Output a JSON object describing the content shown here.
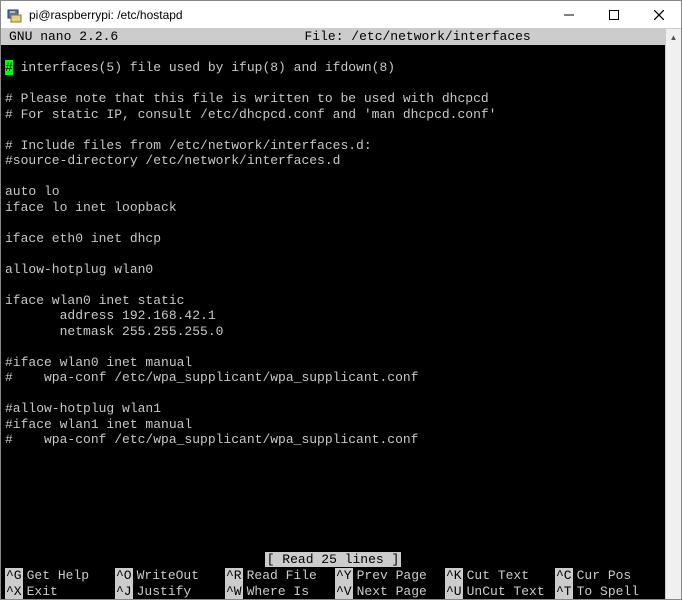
{
  "window": {
    "title": "pi@raspberrypi: /etc/hostapd"
  },
  "nano": {
    "app": "GNU nano 2.2.6",
    "file_label": "File: /etc/network/interfaces",
    "lines": [
      "# interfaces(5) file used by ifup(8) and ifdown(8)",
      "",
      "# Please note that this file is written to be used with dhcpcd",
      "# For static IP, consult /etc/dhcpcd.conf and 'man dhcpcd.conf'",
      "",
      "# Include files from /etc/network/interfaces.d:",
      "#source-directory /etc/network/interfaces.d",
      "",
      "auto lo",
      "iface lo inet loopback",
      "",
      "iface eth0 inet dhcp",
      "",
      "allow-hotplug wlan0",
      "",
      "iface wlan0 inet static",
      "       address 192.168.42.1",
      "       netmask 255.255.255.0",
      "",
      "#iface wlan0 inet manual",
      "#    wpa-conf /etc/wpa_supplicant/wpa_supplicant.conf",
      "",
      "#allow-hotplug wlan1",
      "#iface wlan1 inet manual",
      "#    wpa-conf /etc/wpa_supplicant/wpa_supplicant.conf"
    ],
    "status": "[ Read 25 lines ]",
    "shortcuts_row1": [
      {
        "key": "^G",
        "label": "Get Help"
      },
      {
        "key": "^O",
        "label": "WriteOut"
      },
      {
        "key": "^R",
        "label": "Read File"
      },
      {
        "key": "^Y",
        "label": "Prev Page"
      },
      {
        "key": "^K",
        "label": "Cut Text"
      },
      {
        "key": "^C",
        "label": "Cur Pos"
      }
    ],
    "shortcuts_row2": [
      {
        "key": "^X",
        "label": "Exit"
      },
      {
        "key": "^J",
        "label": "Justify"
      },
      {
        "key": "^W",
        "label": "Where Is"
      },
      {
        "key": "^V",
        "label": "Next Page"
      },
      {
        "key": "^U",
        "label": "UnCut Text"
      },
      {
        "key": "^T",
        "label": "To Spell"
      }
    ]
  }
}
